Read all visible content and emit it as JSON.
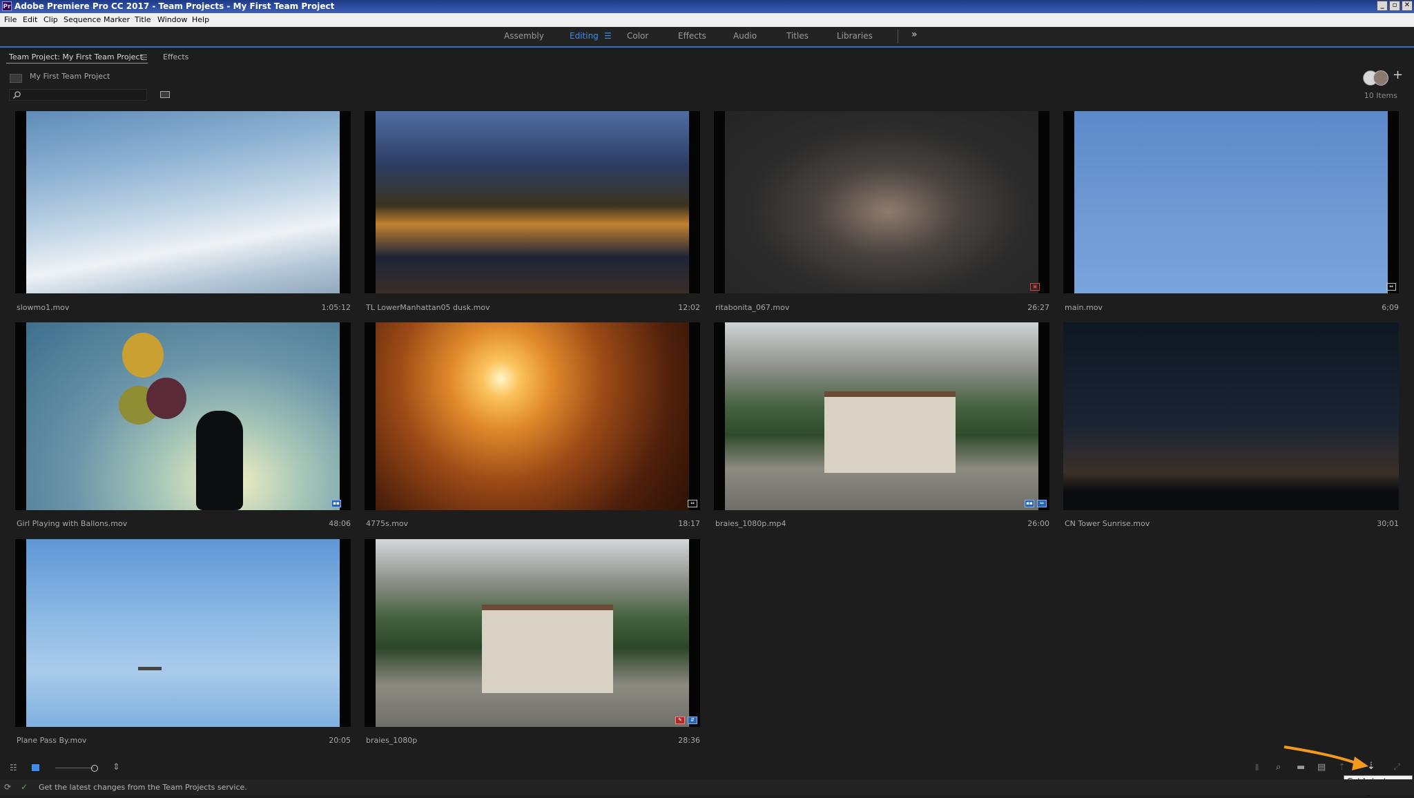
{
  "window": {
    "title": "Adobe Premiere Pro CC 2017 - Team Projects - My First Team Project",
    "app_icon": "Pr"
  },
  "menu": [
    "File",
    "Edit",
    "Clip",
    "Sequence",
    "Marker",
    "Title",
    "Window",
    "Help"
  ],
  "workspaces": {
    "tabs": [
      "Assembly",
      "Editing",
      "Color",
      "Effects",
      "Audio",
      "Titles",
      "Libraries"
    ],
    "active": "Editing",
    "overflow_icon": "»"
  },
  "panel": {
    "tabs": [
      "Team Project: My First Team Project",
      "Effects"
    ],
    "breadcrumb": "My First Team Project",
    "item_count": "10 Items",
    "search_placeholder": ""
  },
  "clips": [
    {
      "name": "slowmo1.mov",
      "duration": "1:05:12",
      "badges": []
    },
    {
      "name": "TL LowerManhattan05 dusk.mov",
      "duration": "12:02",
      "badges": []
    },
    {
      "name": "ritabonita_067.mov",
      "duration": "26:27",
      "badges": [
        "red"
      ]
    },
    {
      "name": "main.mov",
      "duration": "6;09",
      "badges": [
        "white"
      ]
    },
    {
      "name": "Girl Playing with Ballons.mov",
      "duration": "48:06",
      "badges": [
        "blue"
      ]
    },
    {
      "name": "4775s.mov",
      "duration": "18:17",
      "badges": [
        "white"
      ]
    },
    {
      "name": "braies_1080p.mp4",
      "duration": "26:00",
      "badges": [
        "blue",
        "blue"
      ]
    },
    {
      "name": "CN Tower Sunrise.mov",
      "duration": "30;01",
      "badges": []
    },
    {
      "name": "Plane Pass By.mov",
      "duration": "20:05",
      "badges": []
    },
    {
      "name": "braies_1080p",
      "duration": "28:36",
      "badges": [
        "red",
        "blue"
      ]
    }
  ],
  "status": {
    "message": "Get the latest changes from the Team Projects service."
  },
  "tooltip": "Get Latest Changes",
  "colors": {
    "accent": "#3b8eea",
    "arrow": "#f39a1c"
  }
}
